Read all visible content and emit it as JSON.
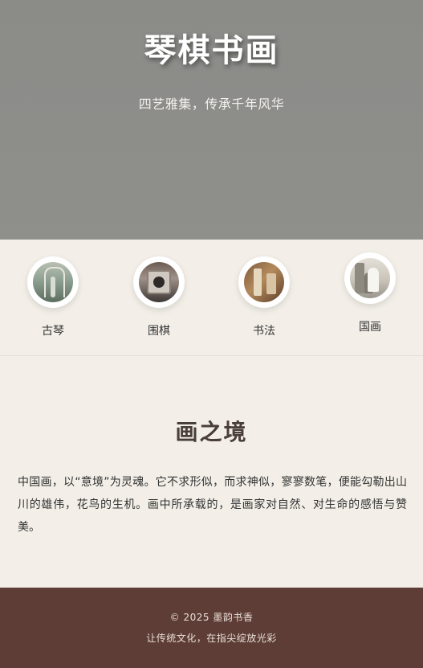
{
  "hero": {
    "title": "琴棋书画",
    "subtitle": "四艺雅集，传承千年风华"
  },
  "nav": {
    "items": [
      {
        "label": "古琴",
        "image": "guqin-thumbnail"
      },
      {
        "label": "围棋",
        "image": "weiqi-thumbnail"
      },
      {
        "label": "书法",
        "image": "shufa-thumbnail"
      },
      {
        "label": "国画",
        "image": "guohua-thumbnail"
      }
    ]
  },
  "section": {
    "title": "画之境",
    "body": "中国画，以“意境”为灵魂。它不求形似，而求神似，寥寥数笔，便能勾勒出山川的雄伟，花鸟的生机。画中所承载的，是画家对自然、对生命的感悟与赞美。"
  },
  "footer": {
    "copyright": "© 2025 墨韵书香",
    "tagline": "让传统文化，在指尖绽放光彩"
  },
  "colors": {
    "hero_bg": "#8d8d8a",
    "page_bg": "#f3efe8",
    "footer_bg": "#5d3d35"
  }
}
